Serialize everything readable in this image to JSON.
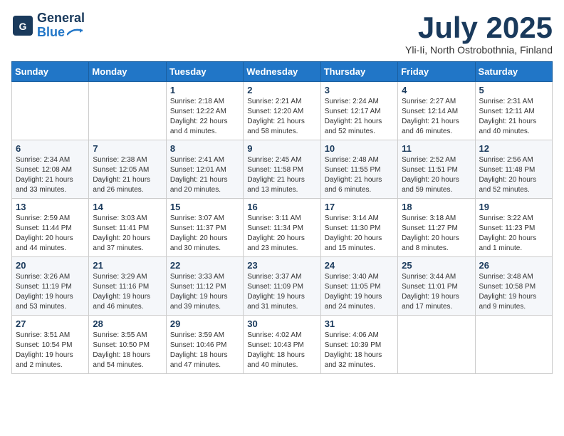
{
  "header": {
    "logo_line1": "General",
    "logo_line2": "Blue",
    "month_title": "July 2025",
    "subtitle": "Yli-Ii, North Ostrobothnia, Finland"
  },
  "weekdays": [
    "Sunday",
    "Monday",
    "Tuesday",
    "Wednesday",
    "Thursday",
    "Friday",
    "Saturday"
  ],
  "weeks": [
    [
      {
        "day": "",
        "info": ""
      },
      {
        "day": "",
        "info": ""
      },
      {
        "day": "1",
        "info": "Sunrise: 2:18 AM\nSunset: 12:22 AM\nDaylight: 22 hours\nand 4 minutes."
      },
      {
        "day": "2",
        "info": "Sunrise: 2:21 AM\nSunset: 12:20 AM\nDaylight: 21 hours\nand 58 minutes."
      },
      {
        "day": "3",
        "info": "Sunrise: 2:24 AM\nSunset: 12:17 AM\nDaylight: 21 hours\nand 52 minutes."
      },
      {
        "day": "4",
        "info": "Sunrise: 2:27 AM\nSunset: 12:14 AM\nDaylight: 21 hours\nand 46 minutes."
      },
      {
        "day": "5",
        "info": "Sunrise: 2:31 AM\nSunset: 12:11 AM\nDaylight: 21 hours\nand 40 minutes."
      }
    ],
    [
      {
        "day": "6",
        "info": "Sunrise: 2:34 AM\nSunset: 12:08 AM\nDaylight: 21 hours\nand 33 minutes."
      },
      {
        "day": "7",
        "info": "Sunrise: 2:38 AM\nSunset: 12:05 AM\nDaylight: 21 hours\nand 26 minutes."
      },
      {
        "day": "8",
        "info": "Sunrise: 2:41 AM\nSunset: 12:01 AM\nDaylight: 21 hours\nand 20 minutes."
      },
      {
        "day": "9",
        "info": "Sunrise: 2:45 AM\nSunset: 11:58 PM\nDaylight: 21 hours\nand 13 minutes."
      },
      {
        "day": "10",
        "info": "Sunrise: 2:48 AM\nSunset: 11:55 PM\nDaylight: 21 hours\nand 6 minutes."
      },
      {
        "day": "11",
        "info": "Sunrise: 2:52 AM\nSunset: 11:51 PM\nDaylight: 20 hours\nand 59 minutes."
      },
      {
        "day": "12",
        "info": "Sunrise: 2:56 AM\nSunset: 11:48 PM\nDaylight: 20 hours\nand 52 minutes."
      }
    ],
    [
      {
        "day": "13",
        "info": "Sunrise: 2:59 AM\nSunset: 11:44 PM\nDaylight: 20 hours\nand 44 minutes."
      },
      {
        "day": "14",
        "info": "Sunrise: 3:03 AM\nSunset: 11:41 PM\nDaylight: 20 hours\nand 37 minutes."
      },
      {
        "day": "15",
        "info": "Sunrise: 3:07 AM\nSunset: 11:37 PM\nDaylight: 20 hours\nand 30 minutes."
      },
      {
        "day": "16",
        "info": "Sunrise: 3:11 AM\nSunset: 11:34 PM\nDaylight: 20 hours\nand 23 minutes."
      },
      {
        "day": "17",
        "info": "Sunrise: 3:14 AM\nSunset: 11:30 PM\nDaylight: 20 hours\nand 15 minutes."
      },
      {
        "day": "18",
        "info": "Sunrise: 3:18 AM\nSunset: 11:27 PM\nDaylight: 20 hours\nand 8 minutes."
      },
      {
        "day": "19",
        "info": "Sunrise: 3:22 AM\nSunset: 11:23 PM\nDaylight: 20 hours\nand 1 minute."
      }
    ],
    [
      {
        "day": "20",
        "info": "Sunrise: 3:26 AM\nSunset: 11:19 PM\nDaylight: 19 hours\nand 53 minutes."
      },
      {
        "day": "21",
        "info": "Sunrise: 3:29 AM\nSunset: 11:16 PM\nDaylight: 19 hours\nand 46 minutes."
      },
      {
        "day": "22",
        "info": "Sunrise: 3:33 AM\nSunset: 11:12 PM\nDaylight: 19 hours\nand 39 minutes."
      },
      {
        "day": "23",
        "info": "Sunrise: 3:37 AM\nSunset: 11:09 PM\nDaylight: 19 hours\nand 31 minutes."
      },
      {
        "day": "24",
        "info": "Sunrise: 3:40 AM\nSunset: 11:05 PM\nDaylight: 19 hours\nand 24 minutes."
      },
      {
        "day": "25",
        "info": "Sunrise: 3:44 AM\nSunset: 11:01 PM\nDaylight: 19 hours\nand 17 minutes."
      },
      {
        "day": "26",
        "info": "Sunrise: 3:48 AM\nSunset: 10:58 PM\nDaylight: 19 hours\nand 9 minutes."
      }
    ],
    [
      {
        "day": "27",
        "info": "Sunrise: 3:51 AM\nSunset: 10:54 PM\nDaylight: 19 hours\nand 2 minutes."
      },
      {
        "day": "28",
        "info": "Sunrise: 3:55 AM\nSunset: 10:50 PM\nDaylight: 18 hours\nand 54 minutes."
      },
      {
        "day": "29",
        "info": "Sunrise: 3:59 AM\nSunset: 10:46 PM\nDaylight: 18 hours\nand 47 minutes."
      },
      {
        "day": "30",
        "info": "Sunrise: 4:02 AM\nSunset: 10:43 PM\nDaylight: 18 hours\nand 40 minutes."
      },
      {
        "day": "31",
        "info": "Sunrise: 4:06 AM\nSunset: 10:39 PM\nDaylight: 18 hours\nand 32 minutes."
      },
      {
        "day": "",
        "info": ""
      },
      {
        "day": "",
        "info": ""
      }
    ]
  ]
}
